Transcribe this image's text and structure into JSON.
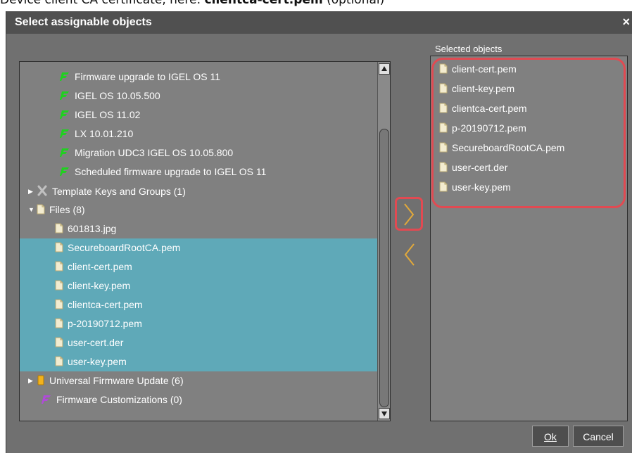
{
  "caption": {
    "prefix": "Device client CA certificate, here: ",
    "bold": "clientca-cert.pem",
    "suffix": " (optional)"
  },
  "dialog": {
    "title": "Select assignable objects",
    "close_glyph": "×",
    "selected_label": "Selected objects",
    "ok_label": "Ok",
    "cancel_label": "Cancel"
  },
  "tree": {
    "items": [
      {
        "label": "Firmware upgrade to IGEL OS 11",
        "icon": "firmware-update-icon"
      },
      {
        "label": "IGEL OS 10.05.500",
        "icon": "firmware-update-icon"
      },
      {
        "label": "IGEL OS 11.02",
        "icon": "firmware-update-icon"
      },
      {
        "label": "LX 10.01.210",
        "icon": "firmware-update-icon"
      },
      {
        "label": "Migration UDC3 IGEL OS 10.05.800",
        "icon": "firmware-update-icon"
      },
      {
        "label": "Scheduled firmware upgrade to IGEL OS 11",
        "icon": "firmware-update-icon"
      },
      {
        "label": "Template Keys and Groups (1)",
        "icon": "template-keys-icon"
      },
      {
        "label": "Files (8)",
        "icon": "file-icon"
      },
      {
        "label": "601813.jpg",
        "icon": "file-icon"
      },
      {
        "label": "SecureboardRootCA.pem",
        "icon": "file-icon"
      },
      {
        "label": "client-cert.pem",
        "icon": "file-icon"
      },
      {
        "label": "client-key.pem",
        "icon": "file-icon"
      },
      {
        "label": "clientca-cert.pem",
        "icon": "file-icon"
      },
      {
        "label": "p-20190712.pem",
        "icon": "file-icon"
      },
      {
        "label": "user-cert.der",
        "icon": "file-icon"
      },
      {
        "label": "user-key.pem",
        "icon": "file-icon"
      },
      {
        "label": "Universal Firmware Update (6)",
        "icon": "universal-firmware-icon"
      },
      {
        "label": "Firmware Customizations (0)",
        "icon": "firmware-customization-icon"
      }
    ]
  },
  "selected": {
    "items": [
      {
        "label": "client-cert.pem"
      },
      {
        "label": "client-key.pem"
      },
      {
        "label": "clientca-cert.pem"
      },
      {
        "label": "p-20190712.pem"
      },
      {
        "label": "SecureboardRootCA.pem"
      },
      {
        "label": "user-cert.der"
      },
      {
        "label": "user-key.pem"
      }
    ]
  },
  "colors": {
    "selection": "#5fa9b8",
    "highlight": "#e14a52",
    "arrow": "#e2a93a",
    "firmware_green": "#1fd11f"
  }
}
